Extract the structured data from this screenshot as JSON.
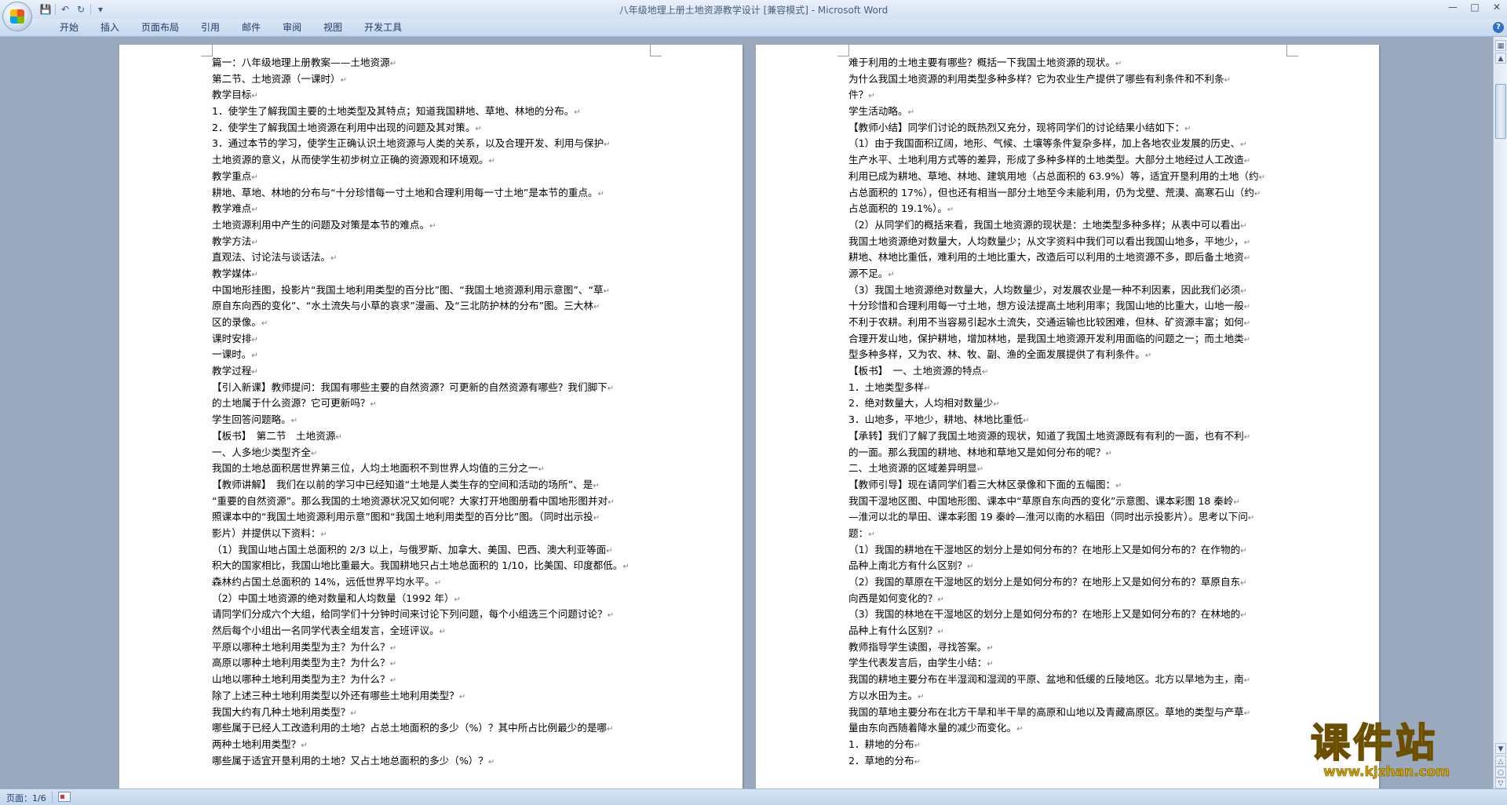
{
  "window": {
    "title": "八年级地理上册土地资源教学设计 [兼容模式] - Microsoft Word"
  },
  "quick_access": {
    "save_icon": "save-icon",
    "undo_icon": "undo-icon",
    "redo_icon": "redo-icon",
    "customize_icon": "chevron-down-icon"
  },
  "ribbon": {
    "tabs": [
      "开始",
      "插入",
      "页面布局",
      "引用",
      "邮件",
      "审阅",
      "视图",
      "开发工具"
    ]
  },
  "document": {
    "left_page": [
      "篇一：八年级地理上册教案——土地资源",
      "第二节、土地资源（一课时）",
      "教学目标",
      "1．使学生了解我国主要的土地类型及其特点；知道我国耕地、草地、林地的分布。",
      "2．使学生了解我国土地资源在利用中出现的问题及其对策。",
      "3．通过本节的学习，使学生正确认识土地资源与人类的关系，以及合理开发、利用与保护",
      "土地资源的意义，从而使学生初步树立正确的资源观和环境观。",
      "教学重点",
      "耕地、草地、林地的分布与“十分珍惜每一寸土地和合理利用每一寸土地”是本节的重点。",
      "教学难点",
      "土地资源利用中产生的问题及对策是本节的难点。",
      "教学方法",
      "直观法、讨论法与谈话法。",
      "教学媒体",
      "中国地形挂图，投影片“我国土地利用类型的百分比”图、“我国土地资源利用示意图”、“草",
      "原自东向西的变化”、“水土流失与小草的哀求”漫画、及“三北防护林的分布”图。三大林",
      "区的录像。",
      "课时安排",
      "一课时。",
      "教学过程",
      "【引入新课】教师提问：我国有哪些主要的自然资源？可更新的自然资源有哪些？我们脚下",
      "的土地属于什么资源？它可更新吗？",
      "学生回答问题略。",
      "【板书】　第二节　土地资源",
      "一、人多地少类型齐全",
      "我国的土地总面积居世界第三位，人均土地面积不到世界人均值的三分之一",
      "【教师讲解】　我们在以前的学习中已经知道“土地是人类生存的空间和活动的场所”、是",
      "“重要的自然资源”。那么我国的土地资源状况又如何呢？大家打开地图册看中国地形图并对",
      "照课本中的“我国土地资源利用示意”图和“我国土地利用类型的百分比”图。（同时出示投",
      "影片）并提供以下资料：",
      "（1）我国山地占国土总面积的 2/3 以上，与俄罗斯、加拿大、美国、巴西、澳大利亚等面",
      "积大的国家相比，我国山地比重最大。我国耕地只占土地总面积的 1/10，比美国、印度都低。",
      "森林约占国土总面积的 14%，远低世界平均水平。",
      "（2）中国土地资源的绝对数量和人均数量（1992 年）",
      "请同学们分成六个大组，给同学们十分钟时间来讨论下列问题，每个小组选三个问题讨论？",
      "然后每个小组出一名同学代表全组发言，全班评议。",
      "平原以哪种土地利用类型为主？为什么？",
      "高原以哪种土地利用类型为主？为什么？",
      "山地以哪种土地利用类型为主？为什么？",
      "除了上述三种土地利用类型以外还有哪些土地利用类型？",
      "我国大约有几种土地利用类型？",
      "哪些属于已经人工改造利用的土地？占总土地面积的多少（%）？其中所占比例最少的是哪",
      "两种土地利用类型？",
      "哪些属于适宜开垦利用的土地？又占土地总面积的多少（%）？"
    ],
    "right_page": [
      "难于利用的土地主要有哪些？概括一下我国土地资源的现状。",
      "为什么我国土地资源的利用类型多种多样？它为农业生产提供了哪些有利条件和不利条",
      "件？",
      "学生活动略。",
      "【教师小结】同学们讨论的既热烈又充分，现将同学们的讨论结果小结如下：",
      "（1）由于我国面积辽阔，地形、气候、土壤等条件复杂多样，加上各地农业发展的历史、",
      "生产水平、土地利用方式等的差异，形成了多种多样的土地类型。大部分土地经过人工改造",
      "利用已成为耕地、草地、林地、建筑用地（占总面积的 63.9%）等，适宜开垦利用的土地（约",
      "占总面积的 17%），但也还有相当一部分土地至今未能利用，仍为戈壁、荒漠、高寒石山（约",
      "占总面积的 19.1%）。",
      "（2）从同学们的概括来看，我国土地资源的现状是：土地类型多种多样；从表中可以看出",
      "我国土地资源绝对数量大，人均数量少；从文字资料中我们可以看出我国山地多，平地少，",
      "耕地、林地比重低，难利用的土地比重大，改造后可以利用的土地资源不多，即后备土地资",
      "源不足。",
      "（3）我国土地资源绝对数量大，人均数量少，对发展农业是一种不利因素，因此我们必须",
      "十分珍惜和合理利用每一寸土地，想方设法提高土地利用率；我国山地的比重大，山地一般",
      "不利于农耕。利用不当容易引起水土流失，交通运输也比较困难，但林、矿资源丰富；如何",
      "合理开发山地，保护耕地，增加林地，是我国土地资源开发利用面临的问题之一；而土地类",
      "型多种多样，又为农、林、牧、副、渔的全面发展提供了有利条件。",
      "【板书】　一、土地资源的特点",
      "1．土地类型多样",
      "2．绝对数量大，人均相对数量少",
      "3．山地多，平地少，耕地、林地比重低",
      "【承转】我们了解了我国土地资源的现状，知道了我国土地资源既有有利的一面，也有不利",
      "的一面。那么我国的耕地、林地和草地又是如何分布的呢？",
      "二、土地资源的区域差异明显",
      "【教师引导】现在请同学们看三大林区录像和下面的五幅图：",
      "我国干湿地区图、中国地形图、课本中“草原自东向西的变化”示意图、课本彩图 18 秦岭",
      "—淮河以北的旱田、课本彩图 19 秦岭—淮河以南的水稻田（同时出示投影片）。思考以下问",
      "题：",
      "（1）我国的耕地在干湿地区的划分上是如何分布的？在地形上又是如何分布的？在作物的",
      "品种上南北方有什么区别？",
      "（2）我国的草原在干湿地区的划分上是如何分布的？在地形上又是如何分布的？草原自东",
      "向西是如何变化的？",
      "（3）我国的林地在干湿地区的划分上是如何分布的？在地形上又是如何分布的？在林地的",
      "品种上有什么区别？",
      "教师指导学生读图，寻找答案。",
      "学生代表发言后，由学生小结：",
      "我国的耕地主要分布在半湿润和湿润的平原、盆地和低缓的丘陵地区。北方以旱地为主，南",
      "方以水田为主。",
      "我国的草地主要分布在北方干旱和半干旱的高原和山地以及青藏高原区。草地的类型与产草",
      "量由东向西随着降水量的减少而变化。",
      "1．耕地的分布",
      "2．草地的分布"
    ]
  },
  "status": {
    "page": "页面：1/6"
  },
  "watermark": {
    "title": "课件站",
    "url": "www.kjzhan.com"
  }
}
